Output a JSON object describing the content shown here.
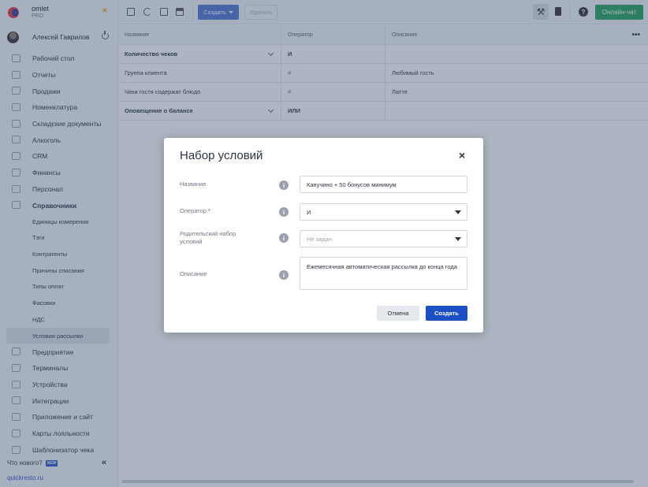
{
  "brand": {
    "name": "omlet",
    "plan": "PRO"
  },
  "user": {
    "name": "Алексей Гаврилов"
  },
  "sidebar": {
    "items": [
      {
        "label": "Рабочий стол",
        "icon": "dashboard-icon"
      },
      {
        "label": "Отчеты",
        "icon": "reports-icon"
      },
      {
        "label": "Продажи",
        "icon": "sales-icon"
      },
      {
        "label": "Номенклатура",
        "icon": "nomenclature-icon"
      },
      {
        "label": "Складские документы",
        "icon": "warehouse-icon"
      },
      {
        "label": "Алкоголь",
        "icon": "alcohol-icon"
      },
      {
        "label": "CRM",
        "icon": "crm-icon"
      },
      {
        "label": "Финансы",
        "icon": "finance-icon"
      },
      {
        "label": "Персонал",
        "icon": "staff-icon"
      },
      {
        "label": "Справочники",
        "icon": "directory-icon"
      }
    ],
    "sub_items": [
      "Единицы измерения",
      "Тэги",
      "Контрагенты",
      "Причины списания",
      "Типы оплат",
      "Фасовки",
      "НДС",
      "Условия рассылки"
    ],
    "items_after": [
      {
        "label": "Предприятие",
        "icon": "enterprise-icon"
      },
      {
        "label": "Терминалы",
        "icon": "terminal-icon"
      },
      {
        "label": "Устройства",
        "icon": "devices-icon"
      },
      {
        "label": "Интеграции",
        "icon": "integrations-icon"
      },
      {
        "label": "Приложение и сайт",
        "icon": "app-icon"
      },
      {
        "label": "Карты лояльности",
        "icon": "loyalty-icon"
      },
      {
        "label": "Шаблонизатор чека",
        "icon": "receipt-icon"
      }
    ],
    "whats_new": "Что нового?",
    "new_badge": "NEW",
    "collapse": "«",
    "site": "quickresto.ru"
  },
  "toolbar": {
    "create_label": "Создать",
    "delete_label": "Удалить",
    "chat_label": "Онлайн-чат",
    "help": "?"
  },
  "table": {
    "headers": [
      "Название",
      "Оператор",
      "Описание"
    ],
    "more": "•••",
    "rows": [
      {
        "name": "Количество чеков",
        "operator": "И",
        "description": "",
        "group": true
      },
      {
        "name": "Группа клиента",
        "operator": "=",
        "description": "Любимый гость",
        "group": false
      },
      {
        "name": "Чеки гостя содержат блюдо",
        "operator": "=",
        "description": "Латте",
        "group": false
      },
      {
        "name": "Оповещение о балансе",
        "operator": "ИЛИ",
        "description": "",
        "group": true
      }
    ]
  },
  "modal": {
    "title": "Набор условий",
    "close": "×",
    "name_label": "Название",
    "name_value": "Капучино + 50 бонусов минимум",
    "operator_label": "Оператор",
    "required_mark": "*",
    "operator_value": "И",
    "parent_label": "Родительский набор условий",
    "parent_placeholder": "Не задан",
    "description_label": "Описание",
    "description_value": "Ежемесячная автоматическая рассылка до конца года",
    "cancel_label": "Отмена",
    "submit_label": "Создать",
    "info": "i"
  },
  "colors": {
    "accent": "#1d4fc4",
    "chat": "#22a35a",
    "sidebar_bg": "#f4f6f9"
  }
}
